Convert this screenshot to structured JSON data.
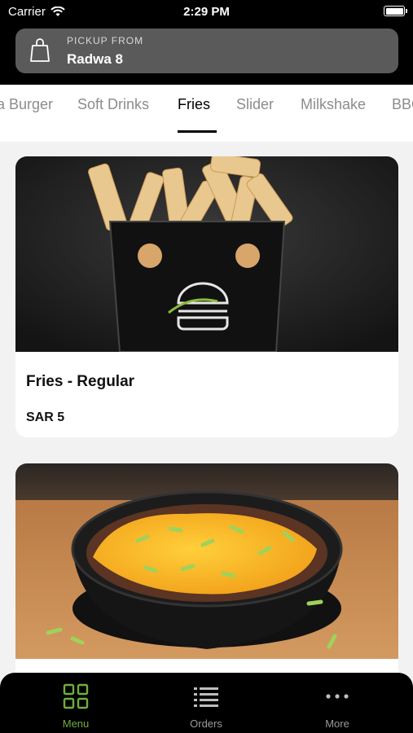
{
  "status_bar": {
    "carrier": "Carrier",
    "time": "2:29 PM"
  },
  "pickup": {
    "label": "PICKUP FROM",
    "location": "Radwa 8"
  },
  "categories": {
    "items": [
      "a Burger",
      "Soft Drinks",
      "Fries",
      "Slider",
      "Milkshake",
      "BBQ"
    ],
    "selected": "Fries"
  },
  "products": [
    {
      "name": "Fries - Regular",
      "price": "SAR 5"
    },
    {
      "name": "",
      "price": ""
    }
  ],
  "bottom_nav": {
    "items": [
      {
        "label": "Menu",
        "icon": "grid-icon"
      },
      {
        "label": "Orders",
        "icon": "list-icon"
      },
      {
        "label": "More",
        "icon": "more-dots-icon"
      }
    ],
    "active": "Menu"
  },
  "colors": {
    "accent": "#6fae3c",
    "header": "#000000",
    "pickup_bg": "#5a5a5a"
  }
}
